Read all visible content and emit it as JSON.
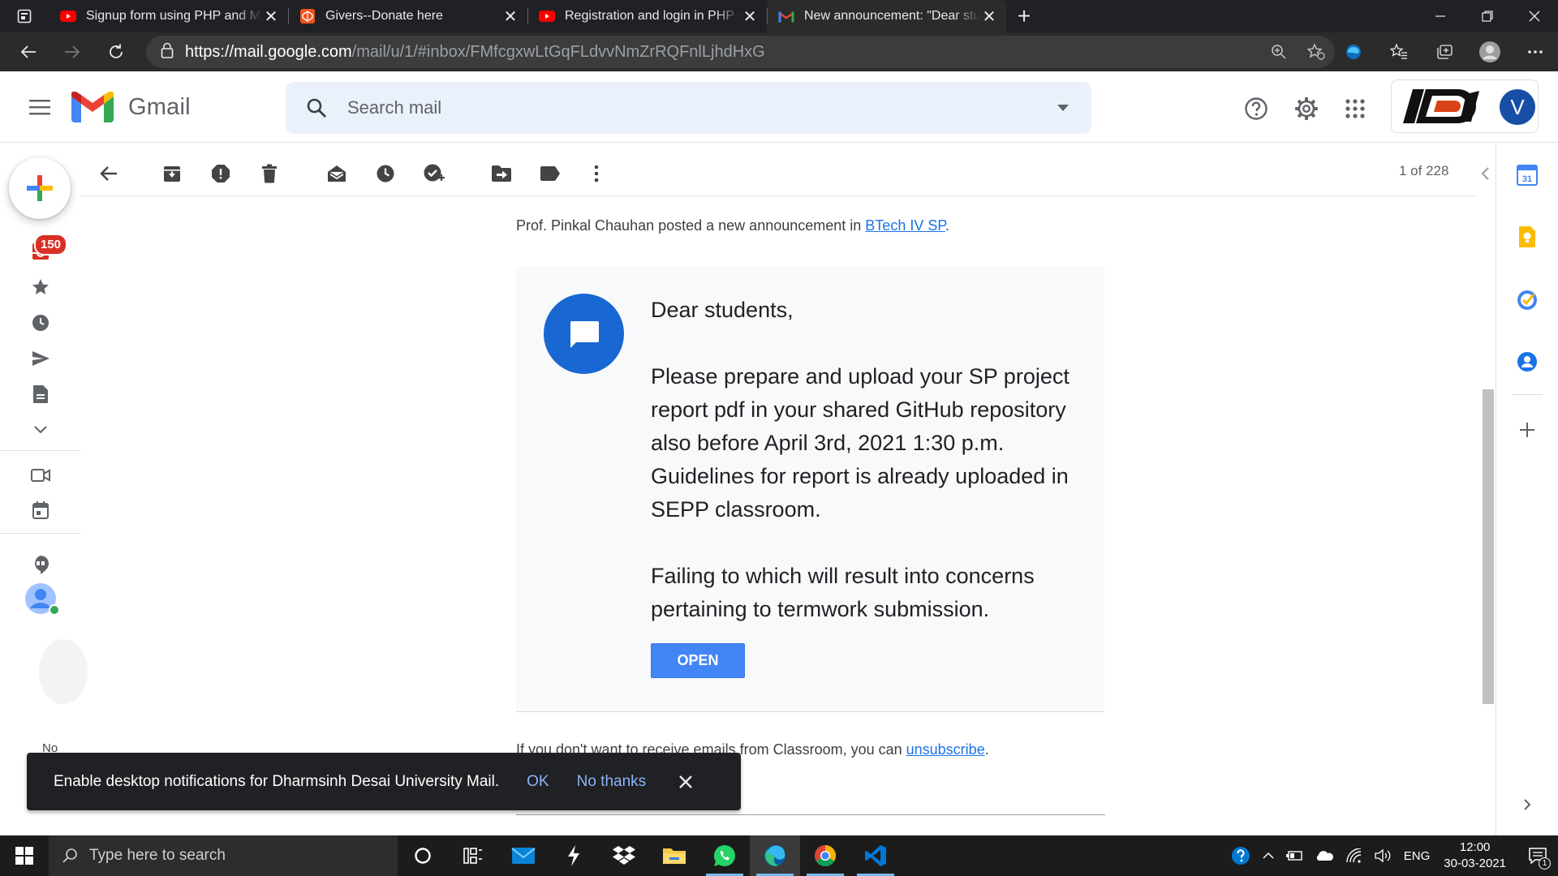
{
  "browser": {
    "tabs": [
      {
        "title": "Signup form using PHP and MyS",
        "favicon": "youtube-icon",
        "active": false
      },
      {
        "title": "Givers--Donate here",
        "favicon": "codepen-icon",
        "active": false
      },
      {
        "title": "Registration and login in PHP wit",
        "favicon": "youtube-icon",
        "active": false
      },
      {
        "title": "New announcement: \"Dear stude",
        "favicon": "gmail-icon",
        "active": true
      }
    ],
    "url_host": "https://mail.google.com",
    "url_path": "/mail/u/1/#inbox/FMfcgxwLtGqFLdvvNmZrRQFnlLjhdHxG"
  },
  "gmail": {
    "product_name": "Gmail",
    "search_placeholder": "Search mail",
    "avatar_initial": "V",
    "unread_badge": "150",
    "pager": "1 of 228",
    "rail_partial_text": "No"
  },
  "message": {
    "posted_prefix": "Prof. Pinkal Chauhan posted a new announcement in ",
    "class_link": "BTech IV SP",
    "posted_suffix": ".",
    "body": [
      "Dear students,",
      "Please prepare and upload your SP project report pdf in your shared GitHub repository also before April 3rd, 2021 1:30 p.m. Guidelines for report is already uploaded in SEPP classroom.",
      "Failing to which will result into concerns pertaining to termwork submission."
    ],
    "open_label": "OPEN",
    "unsub_prefix": "If you don't want to receive emails from Classroom, you can ",
    "unsub_link": "unsubscribe",
    "unsub_suffix": "."
  },
  "snackbar": {
    "message": "Enable desktop notifications for Dharmsinh Desai University Mail.",
    "ok_label": "OK",
    "no_thanks_label": "No thanks"
  },
  "taskbar": {
    "search_placeholder": "Type here to search",
    "language": "ENG",
    "time": "12:00",
    "date": "30-03-2021",
    "notification_count": "1"
  },
  "colors": {
    "gmail_blue": "#1967d2",
    "button_blue": "#4285f4",
    "link_blue": "#1a73e8",
    "badge_red": "#d93025",
    "search_bg": "#eaf1fb"
  }
}
